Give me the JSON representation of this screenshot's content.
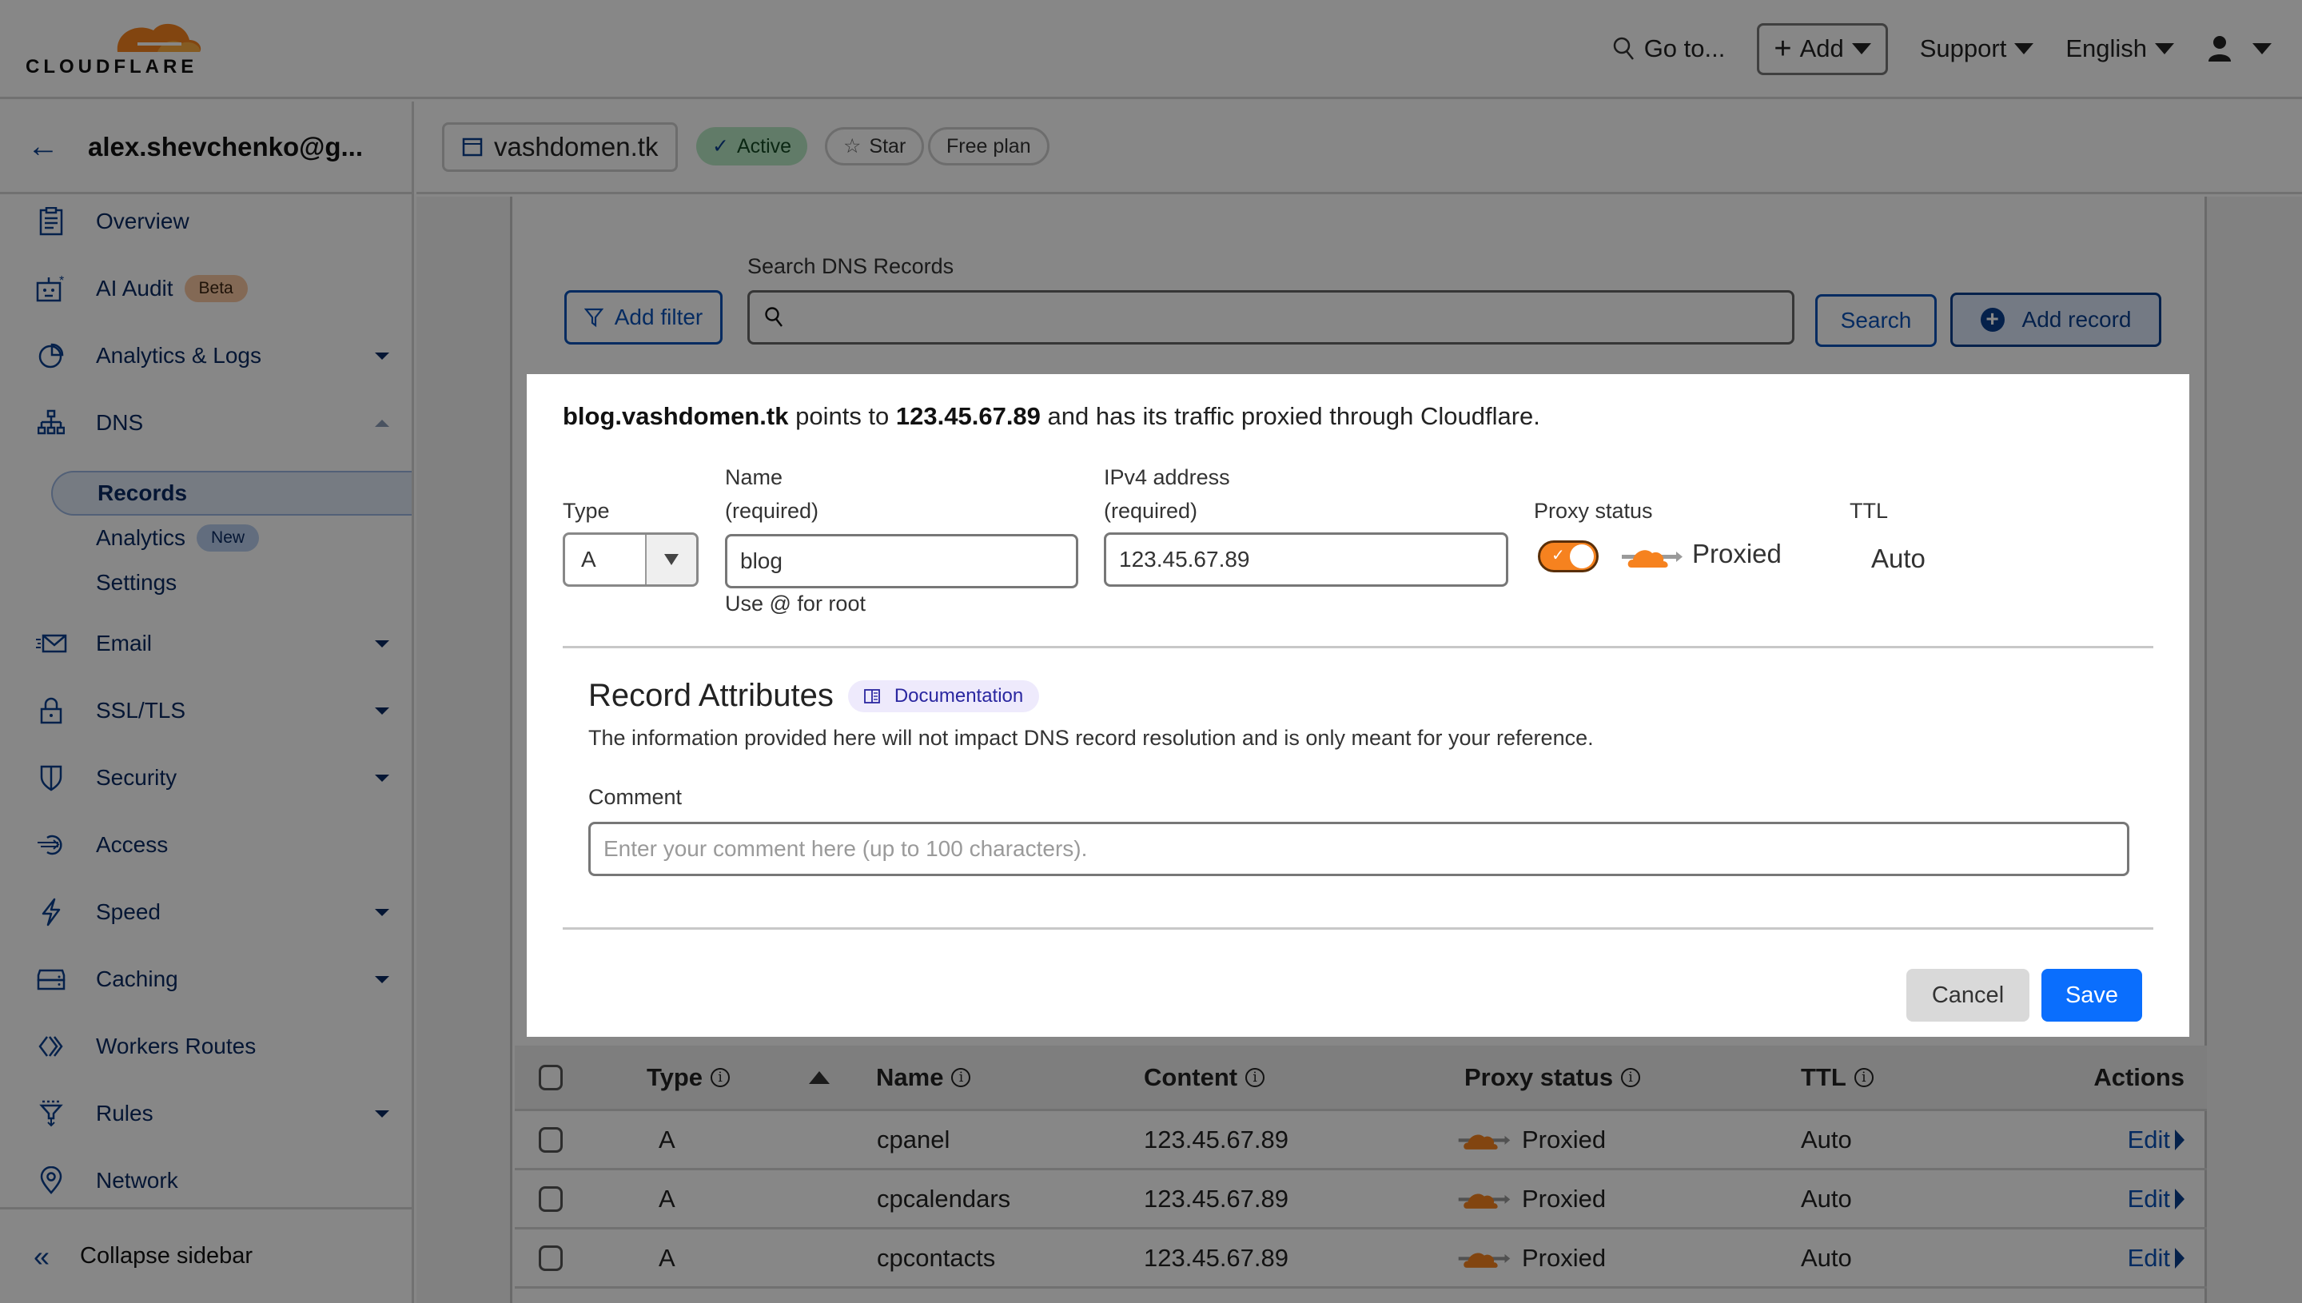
{
  "brand": {
    "name": "CLOUDFLARE",
    "cloud_color": "#f6821f"
  },
  "topbar": {
    "goto_label": "Go to...",
    "add_label": "Add",
    "support_label": "Support",
    "language_label": "English"
  },
  "account": {
    "name": "alex.shevchenko@g..."
  },
  "zone": {
    "name": "vashdomen.tk",
    "status": "Active",
    "star_label": "Star",
    "plan": "Free plan"
  },
  "sidebar": {
    "items": [
      {
        "label": "Overview",
        "icon": "clipboard-icon",
        "caret": false
      },
      {
        "label": "AI Audit",
        "icon": "robot-icon",
        "caret": false,
        "badge": "Beta"
      },
      {
        "label": "Analytics & Logs",
        "icon": "pie-chart-icon",
        "caret": true
      },
      {
        "label": "DNS",
        "icon": "sitemap-icon",
        "caret": true,
        "expanded": true
      },
      {
        "label": "Email",
        "icon": "email-icon",
        "caret": true
      },
      {
        "label": "SSL/TLS",
        "icon": "lock-icon",
        "caret": true
      },
      {
        "label": "Security",
        "icon": "shield-icon",
        "caret": true
      },
      {
        "label": "Access",
        "icon": "access-icon",
        "caret": false
      },
      {
        "label": "Speed",
        "icon": "lightning-icon",
        "caret": true
      },
      {
        "label": "Caching",
        "icon": "server-icon",
        "caret": true
      },
      {
        "label": "Workers Routes",
        "icon": "workers-icon",
        "caret": false
      },
      {
        "label": "Rules",
        "icon": "funnel-icon",
        "caret": true
      },
      {
        "label": "Network",
        "icon": "location-pin-icon",
        "caret": false
      }
    ],
    "dns_sub": [
      {
        "label": "Records",
        "active": true
      },
      {
        "label": "Analytics",
        "badge": "New"
      },
      {
        "label": "Settings"
      }
    ],
    "collapse_label": "Collapse sidebar"
  },
  "toolbar": {
    "add_filter_label": "Add filter",
    "search_label": "Search DNS Records",
    "search_value": "",
    "search_button": "Search",
    "add_record_button": "Add record"
  },
  "edit_record": {
    "summary_name": "blog.vashdomen.tk",
    "summary_mid": " points to ",
    "summary_ip": "123.45.67.89",
    "summary_tail": " and has its traffic proxied through Cloudflare.",
    "type_label": "Type",
    "type_value": "A",
    "name_label": "Name",
    "name_required": "(required)",
    "name_value": "blog",
    "name_hint": "Use @ for root",
    "ipv4_label": "IPv4 address",
    "ipv4_required": "(required)",
    "ipv4_value": "123.45.67.89",
    "proxy_label": "Proxy status",
    "proxy_on": true,
    "proxy_value": "Proxied",
    "ttl_label": "TTL",
    "ttl_value": "Auto",
    "attributes_title": "Record Attributes",
    "documentation_label": "Documentation",
    "attributes_desc": "The information provided here will not impact DNS record resolution and is only meant for your reference.",
    "comment_label": "Comment",
    "comment_value": "",
    "comment_placeholder": "Enter your comment here (up to 100 characters).",
    "cancel_label": "Cancel",
    "save_label": "Save",
    "save_color": "#0a6efd"
  },
  "table": {
    "columns": [
      "Type",
      "Name",
      "Content",
      "Proxy status",
      "TTL",
      "Actions"
    ],
    "rows": [
      {
        "type": "A",
        "name": "cpanel",
        "content": "123.45.67.89",
        "proxy": "Proxied",
        "ttl": "Auto",
        "action": "Edit"
      },
      {
        "type": "A",
        "name": "cpcalendars",
        "content": "123.45.67.89",
        "proxy": "Proxied",
        "ttl": "Auto",
        "action": "Edit"
      },
      {
        "type": "A",
        "name": "cpcontacts",
        "content": "123.45.67.89",
        "proxy": "Proxied",
        "ttl": "Auto",
        "action": "Edit"
      }
    ]
  }
}
